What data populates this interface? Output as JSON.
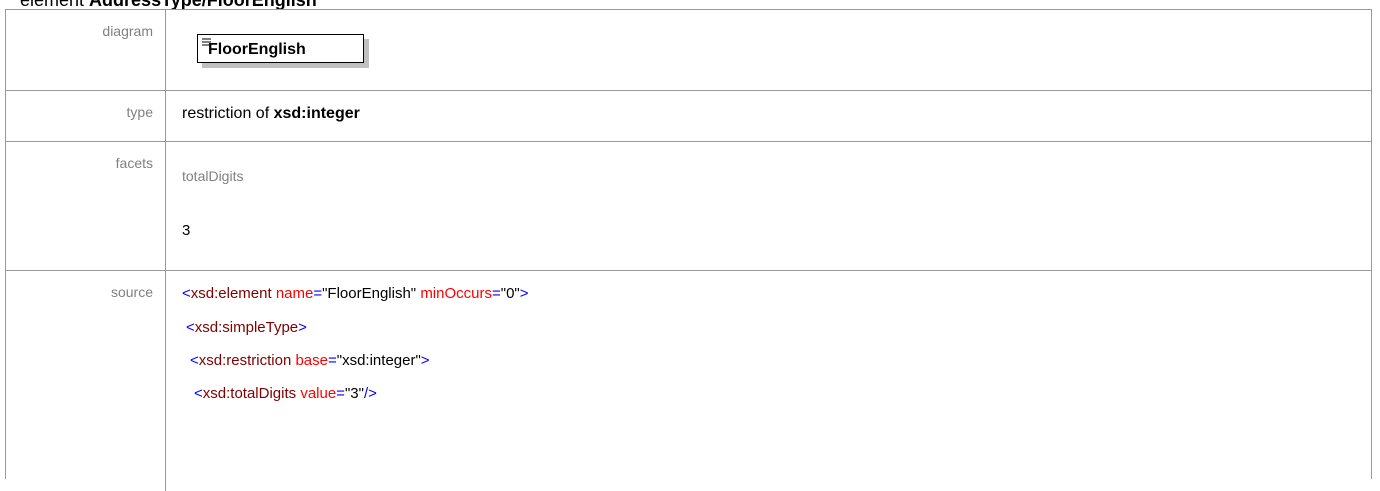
{
  "heading": {
    "prefix": "element ",
    "name": "AddressType/FloorEnglish"
  },
  "rows": {
    "diagram": {
      "label": "diagram",
      "element_name": "FloorEnglish"
    },
    "type": {
      "label": "type",
      "prefix": "restriction of ",
      "base": "xsd:integer"
    },
    "facets": {
      "label": "facets",
      "facet_name": "totalDigits",
      "facet_value": "3"
    },
    "source": {
      "label": "source",
      "lines": [
        {
          "open": "<",
          "tag": "xsd:element",
          "attr1": "name",
          "eq1": "=",
          "val1": "\"FloorEnglish\"",
          "attr2": "minOccurs",
          "eq2": "=",
          "val2": "\"0\"",
          "close": ">"
        },
        {
          "open": "<",
          "tag": "xsd:simpleType",
          "close": ">"
        },
        {
          "open": "<",
          "tag": "xsd:restriction",
          "attr1": "base",
          "eq1": "=",
          "val1": "\"xsd:integer\"",
          "close": ">"
        },
        {
          "open": "<",
          "tag": "xsd:totalDigits",
          "attr1": "value",
          "eq1": "=",
          "val1": "\"3\"",
          "close": "/>"
        }
      ]
    }
  },
  "colors": {
    "border": "#999999",
    "label_text": "#808080",
    "tag": "#800000",
    "bracket": "#0000ff",
    "attribute": "#ff0000"
  }
}
